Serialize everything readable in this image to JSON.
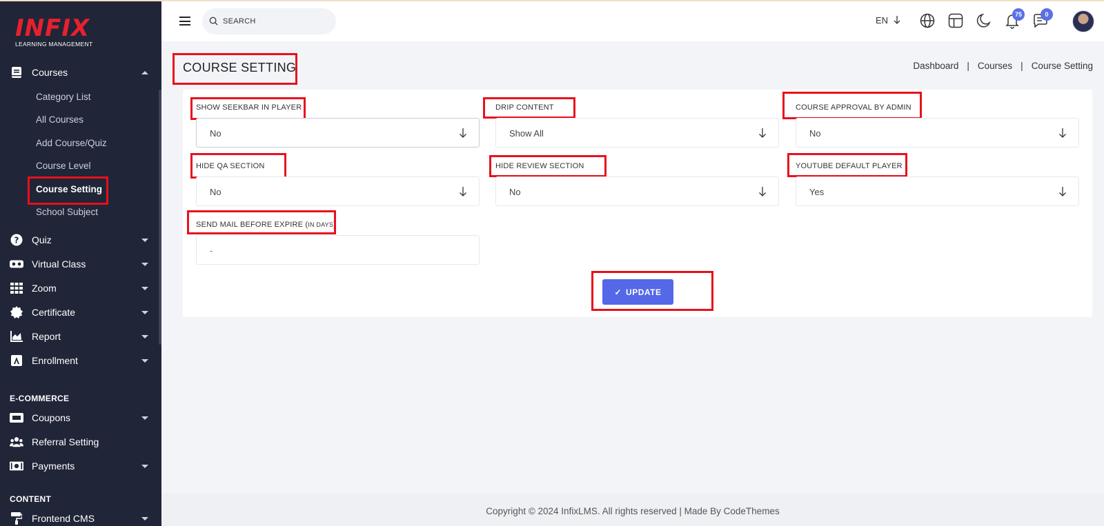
{
  "brand": {
    "logo": "INFIX",
    "tagline": "LEARNING MANAGEMENT"
  },
  "sidebar": {
    "courses": {
      "label": "Courses",
      "icon": "book-icon"
    },
    "sub_items": [
      {
        "label": "Category List"
      },
      {
        "label": "All Courses"
      },
      {
        "label": "Add Course/Quiz"
      },
      {
        "label": "Course Level"
      },
      {
        "label": "Course Setting",
        "active": true
      },
      {
        "label": "School Subject"
      }
    ],
    "items": [
      {
        "label": "Quiz",
        "icon": "question-circle-icon"
      },
      {
        "label": "Virtual Class",
        "icon": "vr-headset-icon"
      },
      {
        "label": "Zoom",
        "icon": "grid-icon"
      },
      {
        "label": "Certificate",
        "icon": "certificate-badge-icon"
      },
      {
        "label": "Report",
        "icon": "area-chart-icon"
      },
      {
        "label": "Enrollment",
        "icon": "enrollment-icon"
      }
    ],
    "ecommerce_heading": "E-COMMERCE",
    "ecommerce_items": [
      {
        "label": "Coupons",
        "icon": "ticket-icon"
      },
      {
        "label": "Referral Setting",
        "icon": "users-icon"
      },
      {
        "label": "Payments",
        "icon": "money-bill-icon"
      }
    ],
    "content_heading": "CONTENT",
    "content_items": [
      {
        "label": "Frontend CMS",
        "icon": "paint-roller-icon"
      }
    ]
  },
  "header": {
    "search_placeholder": "SEARCH",
    "language": "EN",
    "notification_count": "75",
    "message_count": "0"
  },
  "page": {
    "title": "COURSE SETTING",
    "breadcrumb": [
      "Dashboard",
      "Courses",
      "Course Setting"
    ]
  },
  "form": {
    "show_seekbar": {
      "label": "SHOW SEEKBAR IN PLAYER",
      "value": "No"
    },
    "drip_content": {
      "label": "DRIP CONTENT",
      "value": "Show All"
    },
    "course_approval": {
      "label": "COURSE APPROVAL BY ADMIN",
      "value": "No"
    },
    "hide_qa": {
      "label": "HIDE QA SECTION",
      "value": "No"
    },
    "hide_review": {
      "label": "HIDE REVIEW SECTION",
      "value": "No"
    },
    "youtube_player": {
      "label": "YOUTUBE DEFAULT PLAYER",
      "value": "Yes"
    },
    "send_mail": {
      "label": "SEND MAIL BEFORE EXPIRE (",
      "label_small": "IN DAYS",
      "label_end": ")",
      "placeholder": "-"
    },
    "update_label": "UPDATE"
  },
  "footer": {
    "text": "Copyright © 2024 InfixLMS. All rights reserved | Made By CodeThemes"
  },
  "colors": {
    "sidebar_bg": "#202538",
    "accent": "#5568e8",
    "highlight": "#e8101c",
    "logo": "#e8202e"
  }
}
